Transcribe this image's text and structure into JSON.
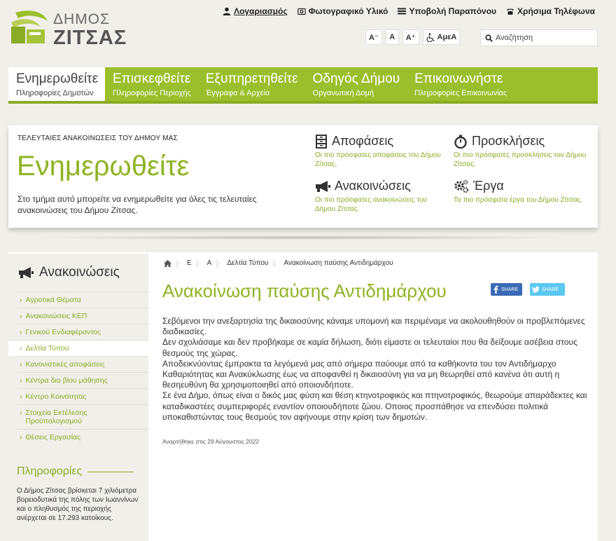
{
  "logo": {
    "small": "ΔΗΜΟΣ",
    "big": "ΖΙΤΣΑΣ"
  },
  "toplinks": [
    {
      "icon": "user-icon",
      "label": "Λογαριασμός"
    },
    {
      "icon": "camera-icon",
      "label": "Φωτογραφικό Υλικό"
    },
    {
      "icon": "list-icon",
      "label": "Υποβολή Παραπόνου"
    },
    {
      "icon": "phone-icon",
      "label": "Χρήσιμα Τηλέφωνα"
    }
  ],
  "font_controls": {
    "decrease": "A⁻",
    "normal": "A",
    "increase": "A⁺",
    "amea": "ΑμεΑ"
  },
  "search": {
    "placeholder": "Αναζήτηση"
  },
  "nav": [
    {
      "title": "Ενημερωθείτε",
      "subtitle": "Πληροφορίες Δημοτών",
      "active": true
    },
    {
      "title": "Επισκεφθείτε",
      "subtitle": "Πληροφορίες Περιοχής"
    },
    {
      "title": "Εξυπηρετηθείτε",
      "subtitle": "Έγγραφα & Αρχεία"
    },
    {
      "title": "Οδηγός Δήμου",
      "subtitle": "Οργανωτική Δομή"
    },
    {
      "title": "Επικοινωνήστε",
      "subtitle": "Πληροφορίες Επικοινωνίας"
    }
  ],
  "hero": {
    "label": "ΤΕΛΕΥΤΑΙΕΣ ΑΝΑΚΟΙΝΩΣΕΙΣ ΤΟΥ ΔΗΜΟΥ ΜΑΣ",
    "title": "Ενημερωθείτε",
    "description": "Στο τμήμα αυτό μπορείτε να ενημερωθείτε για όλες τις τελευταίες ανακοινώσεις του Δήμου Ζίτσας.",
    "cards": [
      {
        "icon": "cabinet-icon",
        "title": "Αποφάσεις",
        "desc": "Οι πιο πρόσφατες αποφάσεις του Δήμου Ζίτσας."
      },
      {
        "icon": "stopwatch-icon",
        "title": "Προσκλήσεις",
        "desc": "Οι πιο πρόσφατες προσκλήσεις του Δήμου Ζίτσας."
      },
      {
        "icon": "megaphone-icon",
        "title": "Ανακοινώσεις",
        "desc": "Οι πιο πρόσφατες ανακοινώσεις του Δήμου Ζίτσας."
      },
      {
        "icon": "gears-icon",
        "title": "Έργα",
        "desc": "Τα πιο πρόσφατα έργα του Δήμου Ζίτσας."
      }
    ]
  },
  "sidebar": {
    "title": "Ανακοινώσεις",
    "items": [
      {
        "label": "Αγροτικά Θέματα"
      },
      {
        "label": "Ανακοινώσεις ΚΕΠ"
      },
      {
        "label": "Γενικού Ενδιαφέροντος"
      },
      {
        "label": "Δελτία Τύπου",
        "active": true
      },
      {
        "label": "Κανονιστικές αποφάσεις"
      },
      {
        "label": "Κέντρα δια βίου μάθησης"
      },
      {
        "label": "Κέντρο Κοινότητας"
      },
      {
        "label": "Στοιχεία Εκτέλεσης Προϋπολογισμού"
      },
      {
        "label": "Θέσεις Εργασίας"
      }
    ],
    "info_title": "Πληροφορίες",
    "info_text": "Ο Δήμος Ζίτσας βρίσκεται 7 χιλιόμετρα βορειοδυτικά της πόλης των Ιωαννίνων και ο πληθυσμός της περιοχής ανέρχεται σε 17.293 κατοίκους."
  },
  "breadcrumb": {
    "b1": "Ε",
    "b2": "Α",
    "b3": "Δελτία Τύπου",
    "b4": "Ανακοίνωση παύσης Αντιδημάρχου"
  },
  "article": {
    "title": "Ανακοίνωση παύσης Αντιδημάρχου",
    "share_fb": "SHARE",
    "share_tw": "SHARE",
    "paragraphs": [
      "Σεβόμενοι την ανεξαρτησία της δικαιοσύνης κάναμε υπομονή και περιμέναμε να ακολουθηθούν οι προβλεπόμενες διαδικασίες.",
      "Δεν σχολιάσαμε και δεν προβήκαμε σε καμία δήλωση, διότι είμαστε οι τελευταίοι που θα δείξουμε ασέβεια στους θεσμούς της χώρας.",
      "Αποδεικνύοντας έμπρακτα τα λεγόμενά μας από σήμερα παύουμε από τα καθήκοντα του τον Αντιδήμαρχο Καθαριότητας και Ανακύκλωσης έως να αποφανθεί η δικαιοσύνη για να μη θεωρηθεί από κανένα ότι αυτή η θεσηευθύνη θα χρησιμοποιηθεί από οποιονδήποτε.",
      "Σε ένα Δήμο, όπως είναι ο δικός μας φύση και θέση κτηνοτροφικός και πτηνοτροφικός, θεωρούμε απαράδεκτες και καταδικαστέες συμπεριφορές εναντίον οποιουδήποτε ζώου. Οποιος προσπάθησε να επενδύσει πολιτικά υποκαθιστώντας τους θεσμούς τον αφήνουμε στην κρίση των δημοτών."
    ],
    "posted": "Αναρτήθηκε στις 29 Αύγουστος 2022"
  }
}
